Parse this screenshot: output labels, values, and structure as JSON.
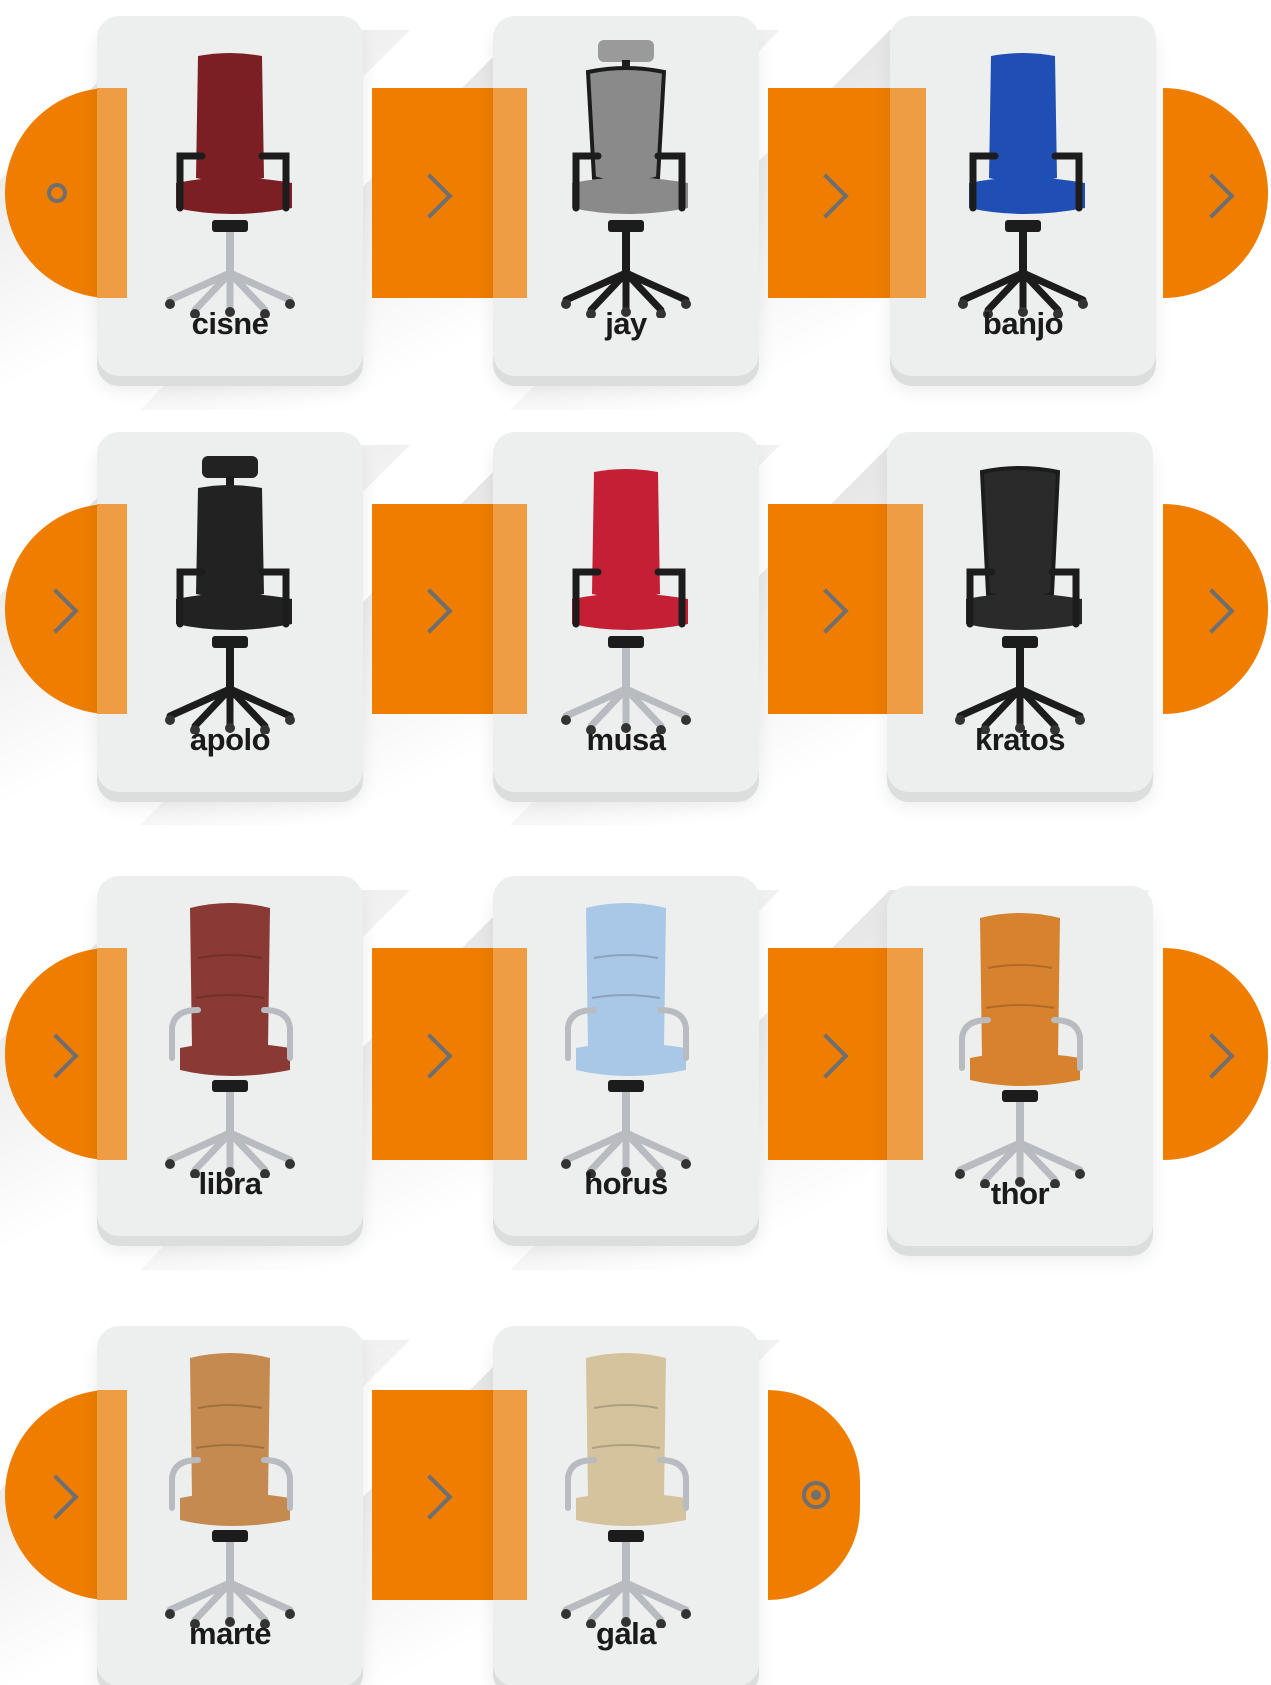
{
  "products": [
    {
      "name": "cisne",
      "color": "#7b1f24",
      "style": "task",
      "headrest": false
    },
    {
      "name": "jay",
      "color": "#8a8a8a",
      "style": "mesh",
      "headrest": true
    },
    {
      "name": "banjo",
      "color": "#1f4fb5",
      "style": "task",
      "headrest": false
    },
    {
      "name": "apolo",
      "color": "#222222",
      "style": "task",
      "headrest": true
    },
    {
      "name": "musa",
      "color": "#c41f34",
      "style": "task",
      "headrest": false
    },
    {
      "name": "kratos",
      "color": "#2a2a2a",
      "style": "mesh",
      "headrest": false
    },
    {
      "name": "libra",
      "color": "#8a3a34",
      "style": "executive",
      "headrest": false
    },
    {
      "name": "horus",
      "color": "#a9c7e6",
      "style": "executive",
      "headrest": false
    },
    {
      "name": "thor",
      "color": "#d7822f",
      "style": "executive",
      "headrest": false
    },
    {
      "name": "marte",
      "color": "#c48a4f",
      "style": "executive",
      "headrest": false
    },
    {
      "name": "gala",
      "color": "#d4c39c",
      "style": "executive",
      "headrest": false
    }
  ],
  "flow": {
    "start_icon": "start-ring-icon",
    "step_icon": "chevron-right-icon",
    "end_icon": "end-target-icon",
    "accent": "#ee7d00",
    "icon_color": "#6f6f6f"
  }
}
